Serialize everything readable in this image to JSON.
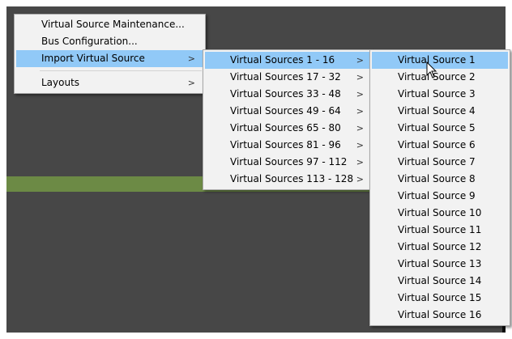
{
  "main_menu": {
    "items": [
      {
        "label": "Virtual Source Maintenance...",
        "has_submenu": false,
        "highlighted": false
      },
      {
        "label": "Bus Configuration...",
        "has_submenu": false,
        "highlighted": false
      },
      {
        "label": "Import Virtual Source",
        "has_submenu": true,
        "highlighted": true
      },
      {
        "label": "Layouts",
        "has_submenu": true,
        "highlighted": false
      }
    ]
  },
  "import_submenu": {
    "items": [
      {
        "label": "Virtual Sources 1 - 16",
        "highlighted": true
      },
      {
        "label": "Virtual Sources 17 - 32",
        "highlighted": false
      },
      {
        "label": "Virtual Sources 33 - 48",
        "highlighted": false
      },
      {
        "label": "Virtual Sources 49 - 64",
        "highlighted": false
      },
      {
        "label": "Virtual Sources 65 - 80",
        "highlighted": false
      },
      {
        "label": "Virtual Sources 81 - 96",
        "highlighted": false
      },
      {
        "label": "Virtual Sources 97 - 112",
        "highlighted": false
      },
      {
        "label": "Virtual Sources 113 - 128",
        "highlighted": false
      }
    ]
  },
  "sources_submenu": {
    "items": [
      {
        "label": "Virtual Source 1",
        "highlighted": true
      },
      {
        "label": "Virtual Source 2",
        "highlighted": false
      },
      {
        "label": "Virtual Source 3",
        "highlighted": false
      },
      {
        "label": "Virtual Source 4",
        "highlighted": false
      },
      {
        "label": "Virtual Source 5",
        "highlighted": false
      },
      {
        "label": "Virtual Source 6",
        "highlighted": false
      },
      {
        "label": "Virtual Source 7",
        "highlighted": false
      },
      {
        "label": "Virtual Source 8",
        "highlighted": false
      },
      {
        "label": "Virtual Source 9",
        "highlighted": false
      },
      {
        "label": "Virtual Source 10",
        "highlighted": false
      },
      {
        "label": "Virtual Source 11",
        "highlighted": false
      },
      {
        "label": "Virtual Source 12",
        "highlighted": false
      },
      {
        "label": "Virtual Source 13",
        "highlighted": false
      },
      {
        "label": "Virtual Source 14",
        "highlighted": false
      },
      {
        "label": "Virtual Source 15",
        "highlighted": false
      },
      {
        "label": "Virtual Source 16",
        "highlighted": false
      }
    ]
  },
  "submenu_arrow": ">",
  "colors": {
    "background": "#474747",
    "green_strip": "#6c8a45",
    "menu_bg": "#f2f2f2",
    "highlight": "#91c9f7"
  },
  "icons": {
    "cursor": "mouse-pointer-icon",
    "submenu_indicator": "chevron-right-icon"
  }
}
